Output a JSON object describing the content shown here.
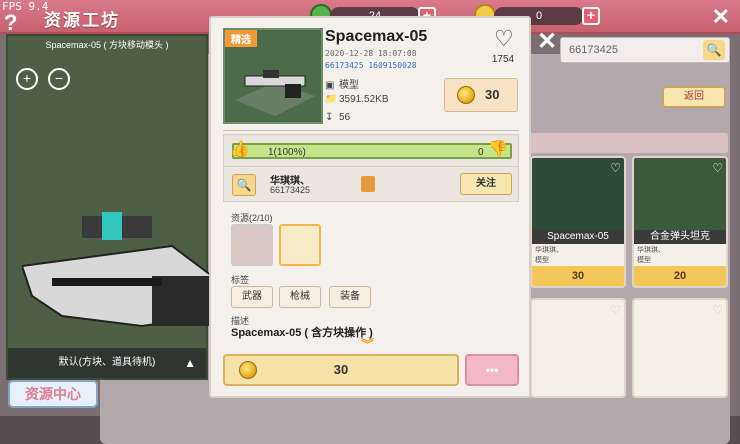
{
  "app": {
    "fps": "FPS 9.4",
    "title": "资源工坊",
    "resource_a_value": "24",
    "resource_b_value": "0",
    "res_center_label": "资源中心"
  },
  "preview": {
    "title": "Spacemax-05 ( 方块移动模头 )",
    "caption": "默认(方块、道具待机)"
  },
  "browse": {
    "search_value": "66173425",
    "back_label": "返回",
    "cards": [
      {
        "name": "Spacemax-05",
        "author": "华琪琪、",
        "type": "模型",
        "price": "30"
      },
      {
        "name": "合金弹头坦克",
        "author": "华琪琪、",
        "type": "模型",
        "price": "20"
      }
    ]
  },
  "detail": {
    "badge": "精选",
    "name": "Spacemax-05",
    "date": "2020-12-28  18:07:08",
    "ids": "66173425  1609150028",
    "type": "模型",
    "size": "3591.52KB",
    "downloads": "56",
    "likes": "1754",
    "price": "30",
    "rating_good": "1(100%)",
    "rating_bad": "0",
    "author_name": "华琪琪、",
    "author_id": "66173425",
    "follow_label": "关注",
    "resources_label": "资源(2/10)",
    "tags_label": "标签",
    "tags": [
      "武器",
      "枪械",
      "装备"
    ],
    "desc_label": "描述",
    "desc": "Spacemax-05 ( 含方块操作 )",
    "buy_price": "30",
    "more_label": "•••"
  },
  "colors": {
    "accent": "#c7606f",
    "rating_fill": "#c6e48a",
    "coin": "#e8b020"
  }
}
